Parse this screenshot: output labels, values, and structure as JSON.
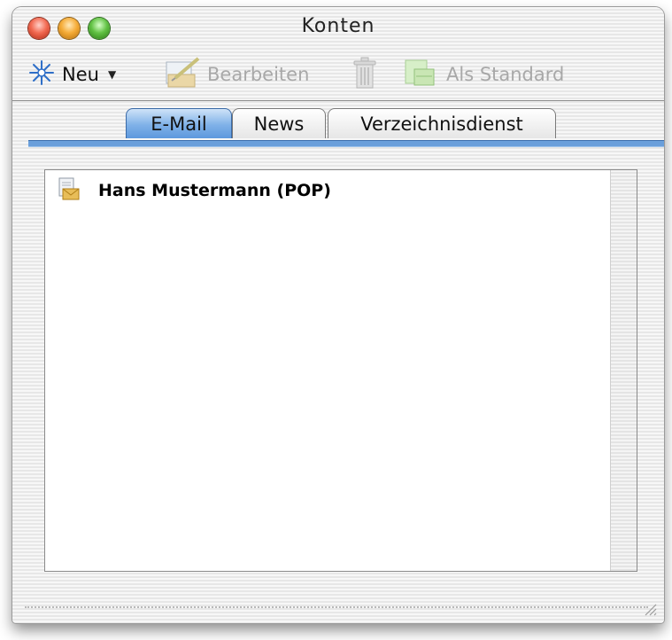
{
  "window": {
    "title": "Konten"
  },
  "toolbar": {
    "new_label": "Neu",
    "edit_label": "Bearbeiten",
    "default_label": "Als Standard"
  },
  "tabs": [
    {
      "label": "E-Mail",
      "selected": true
    },
    {
      "label": "News",
      "selected": false
    },
    {
      "label": "Verzeichnisdienst",
      "selected": false
    }
  ],
  "accounts": [
    {
      "name": "Hans Mustermann (POP)",
      "icon": "mail-account-icon"
    }
  ],
  "colors": {
    "tab_accent": "#6a9fdb"
  }
}
